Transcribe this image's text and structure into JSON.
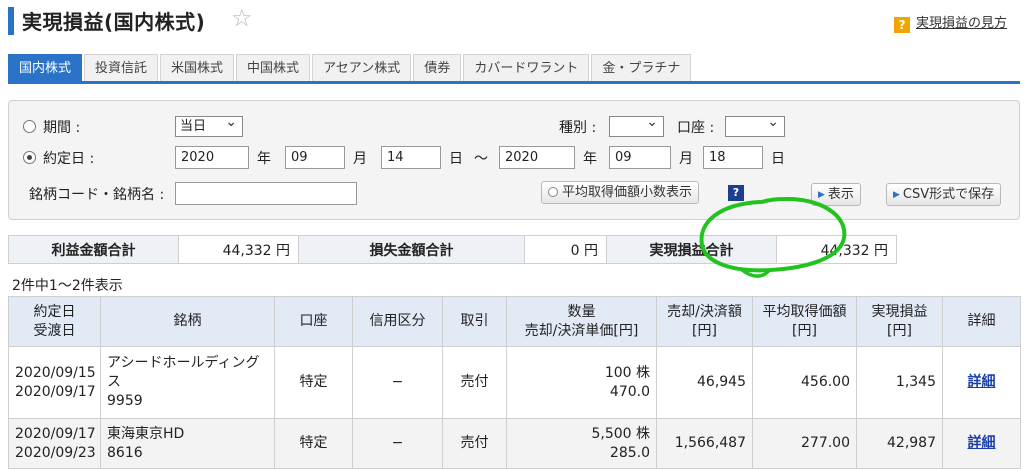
{
  "header": {
    "title": "実現損益(国内株式)",
    "help_link": "実現損益の見方",
    "help_icon": "?"
  },
  "tabs": [
    {
      "label": "国内株式",
      "active": true
    },
    {
      "label": "投資信託"
    },
    {
      "label": "米国株式"
    },
    {
      "label": "中国株式"
    },
    {
      "label": "アセアン株式"
    },
    {
      "label": "債券"
    },
    {
      "label": "カバードワラント"
    },
    {
      "label": "金・プラチナ"
    }
  ],
  "search": {
    "period_label": "期間",
    "period_value": "当日",
    "contract_date_label": "約定日",
    "colon": ":",
    "from_year": "2020",
    "from_month": "09",
    "from_day": "14",
    "to_year": "2020",
    "to_month": "09",
    "to_day": "18",
    "year_unit": "年",
    "month_unit": "月",
    "day_unit": "日",
    "tilde": "〜",
    "type_label": "種別",
    "account_label": "口座",
    "type_value": "",
    "account_value": "",
    "code_label": "銘柄コード・銘柄名",
    "code_value": "",
    "avg_decimal_button": "平均取得価額小数表示",
    "show_button": "表示",
    "csv_button": "CSV形式で保存",
    "help_icon": "?"
  },
  "summary": {
    "profit_label": "利益金額合計",
    "profit_value": "44,332 円",
    "loss_label": "損失金額合計",
    "loss_value": "0 円",
    "realized_label": "実現損益合計",
    "realized_value": "44,332 円"
  },
  "count_text": "2件中1〜2件表示",
  "table": {
    "headers": {
      "date1": "約定日",
      "date2": "受渡日",
      "name": "銘柄",
      "account": "口座",
      "margin": "信用区分",
      "trade": "取引",
      "qty1": "数量",
      "qty2": "売却/決済単価[円]",
      "sale1": "売却/決済額",
      "sale2": "[円]",
      "avg1": "平均取得価額",
      "avg2": "[円]",
      "pl1": "実現損益",
      "pl2": "[円]",
      "detail": "詳細"
    },
    "rows": [
      {
        "contract_date": "2020/09/15",
        "settle_date": "2020/09/17",
        "name": "アシードホールディングス",
        "code": "9959",
        "account": "特定",
        "margin": "−",
        "trade": "売付",
        "qty": "100 株",
        "unit_price": "470.0",
        "sale_amount": "46,945",
        "avg_price": "456.00",
        "realized": "1,345",
        "detail": "詳細"
      },
      {
        "contract_date": "2020/09/17",
        "settle_date": "2020/09/23",
        "name": "東海東京HD",
        "code": "8616",
        "account": "特定",
        "margin": "−",
        "trade": "売付",
        "qty": "5,500 株",
        "unit_price": "285.0",
        "sale_amount": "1,566,487",
        "avg_price": "277.00",
        "realized": "42,987",
        "detail": "詳細"
      }
    ]
  },
  "colors": {
    "accent": "#2a73c8",
    "annotation": "#22c21f",
    "link": "#1a3ea8"
  }
}
